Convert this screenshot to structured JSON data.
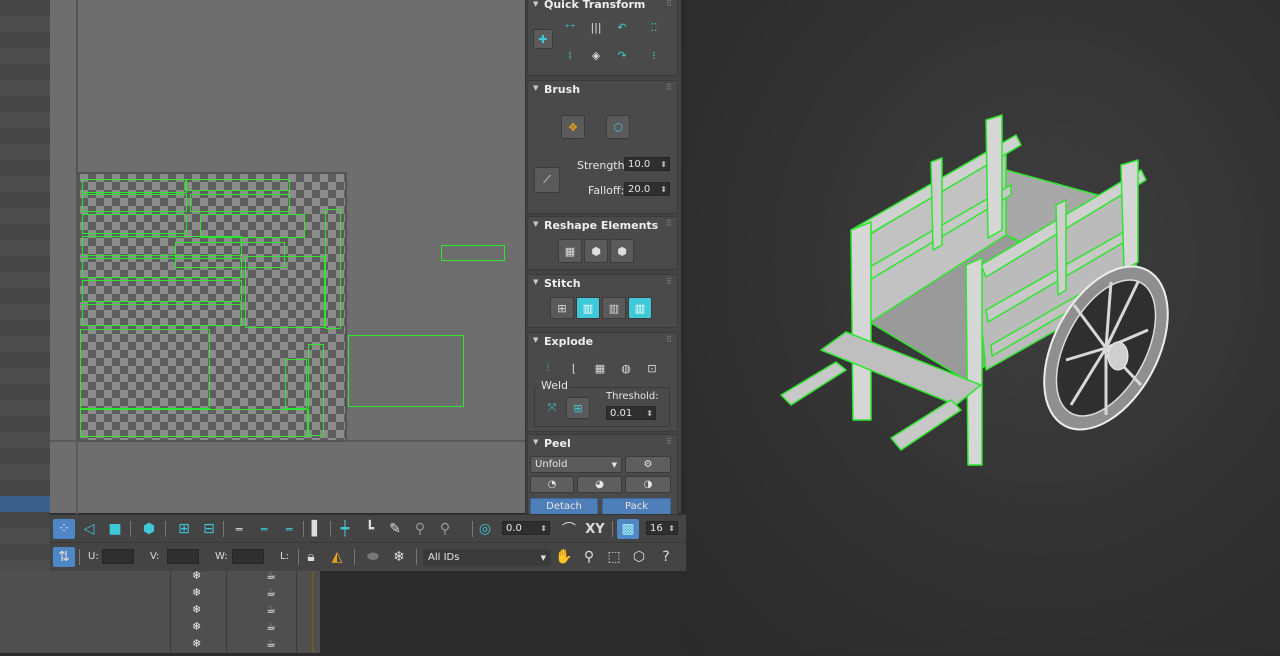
{
  "rollouts": {
    "quick_transform": {
      "title": "Quick Transform"
    },
    "brush": {
      "title": "Brush",
      "strength_label": "Strength:",
      "strength_value": "10.0",
      "falloff_label": "Falloff:",
      "falloff_value": "20.0"
    },
    "reshape": {
      "title": "Reshape Elements"
    },
    "stitch": {
      "title": "Stitch"
    },
    "explode": {
      "title": "Explode",
      "weld_label": "Weld",
      "threshold_label": "Threshold:",
      "threshold_value": "0.01"
    },
    "peel": {
      "title": "Peel",
      "mode_value": "Unfold",
      "detach_label": "Detach",
      "pack_label": "Pack"
    }
  },
  "toolbar": {
    "angle_value": "0.0",
    "xy_label": "XY",
    "grid_value": "16",
    "u_label": "U:",
    "v_label": "V:",
    "w_label": "W:",
    "l_label": "L:",
    "id_filter_value": "All IDs"
  },
  "colors": {
    "uv_edge": "#2ee62e",
    "accent": "#3ec8d8",
    "active_button": "#4e86c6"
  }
}
